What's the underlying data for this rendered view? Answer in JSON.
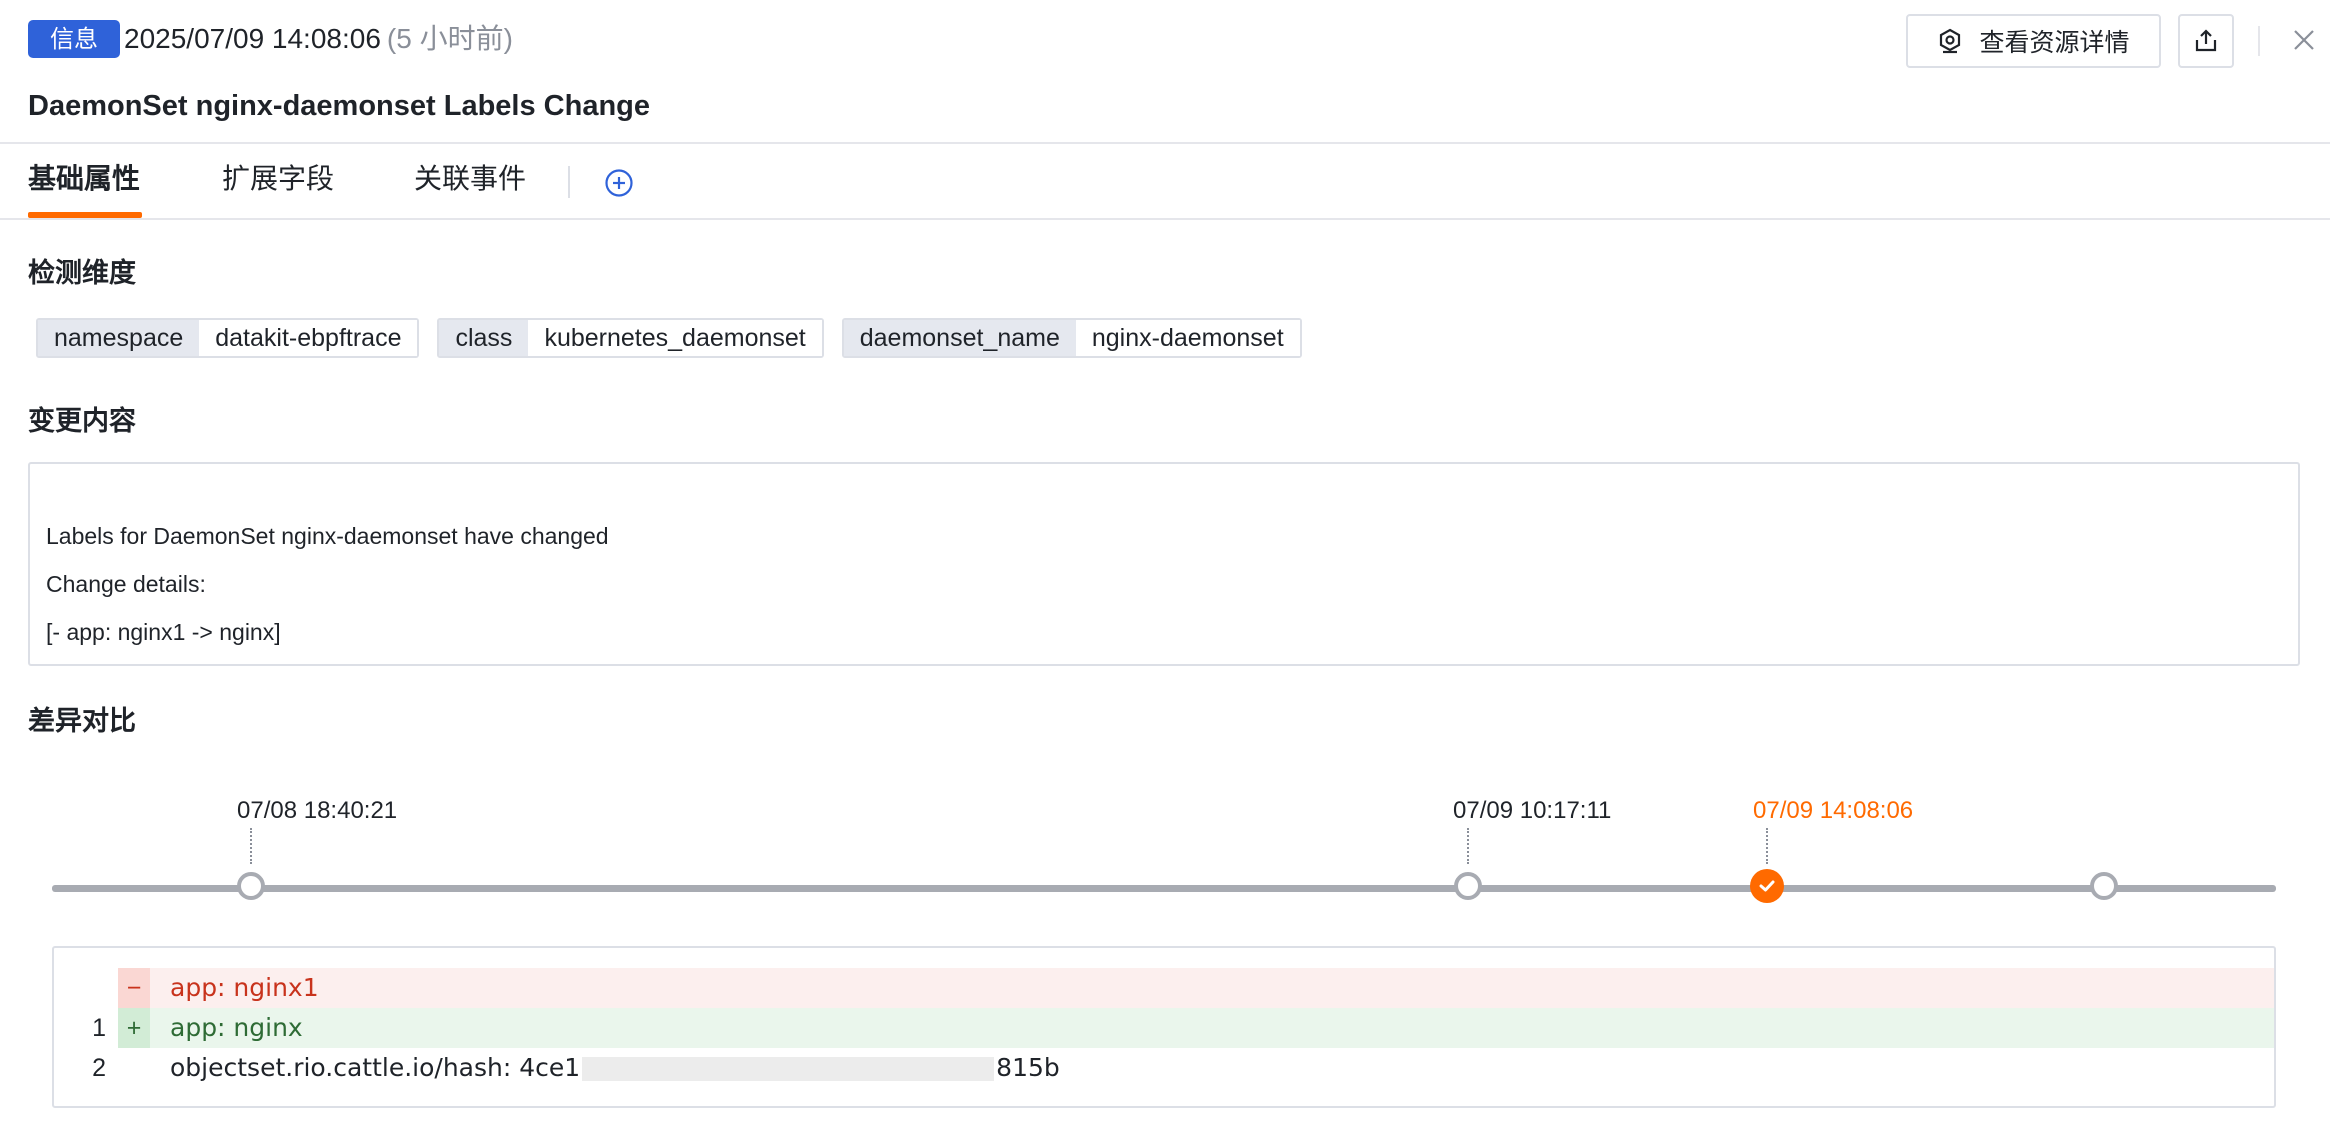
{
  "header": {
    "badge": "信息",
    "timestamp": "2025/07/09 14:08:06",
    "relative_time": "(5 小时前)",
    "title": "DaemonSet nginx-daemonset Labels Change",
    "view_details_label": "查看资源详情",
    "icons": {
      "details": "resource-icon",
      "export": "export-icon",
      "close": "close-icon"
    }
  },
  "tabs": [
    {
      "label": "基础属性",
      "active": true
    },
    {
      "label": "扩展字段",
      "active": false
    },
    {
      "label": "关联事件",
      "active": false
    }
  ],
  "sections": {
    "dimensions_title": "检测维度",
    "change_title": "变更内容",
    "diff_title": "差异对比"
  },
  "dimensions": [
    {
      "key": "namespace",
      "value": "datakit-ebpftrace"
    },
    {
      "key": "class",
      "value": "kubernetes_daemonset"
    },
    {
      "key": "daemonset_name",
      "value": "nginx-daemonset"
    }
  ],
  "change_content": [
    "Labels for DaemonSet nginx-daemonset have changed",
    "Change details:",
    "[- app: nginx1 -> nginx]"
  ],
  "timeline": {
    "labels": [
      "07/08 18:40:21",
      "07/09 10:17:11",
      "07/09 14:08:06"
    ],
    "active_index": 2
  },
  "diff": {
    "rows": [
      {
        "line": "",
        "marker": "−",
        "text": "app: nginx1",
        "type": "del"
      },
      {
        "line": "1",
        "marker": "+",
        "text": "app: nginx",
        "type": "add"
      },
      {
        "line": "2",
        "marker": "",
        "text_before": "objectset.rio.cattle.io/hash: 4ce1",
        "text_after": "815b",
        "type": "ctx"
      }
    ]
  },
  "colors": {
    "badge": "#2f62d9",
    "accent": "#ff6a00",
    "del_text": "#c8331c",
    "add_text": "#2e6b35"
  }
}
